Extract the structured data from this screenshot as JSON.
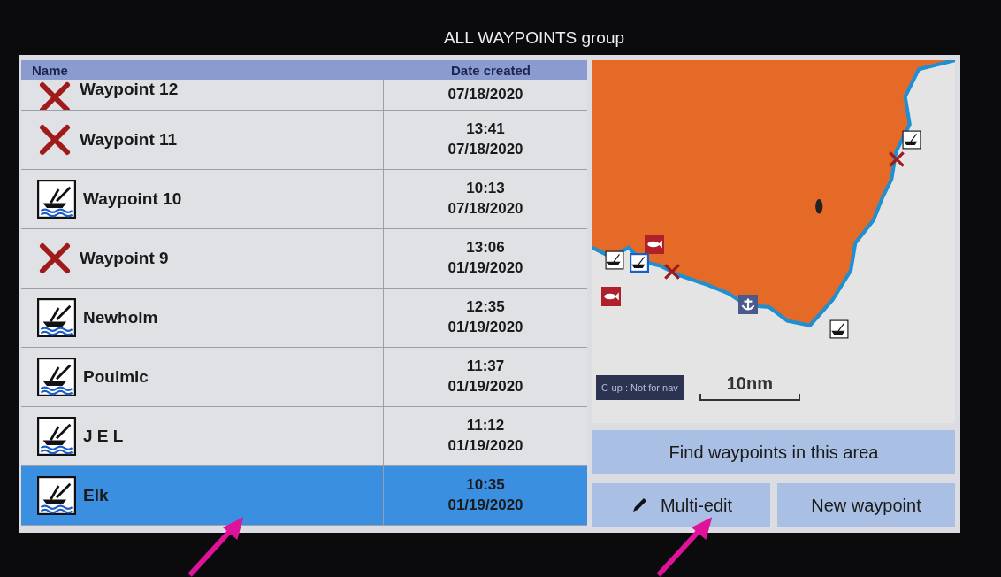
{
  "window": {
    "title": "ALL WAYPOINTS group"
  },
  "table": {
    "columns": [
      "Name",
      "Date created"
    ],
    "rows": [
      {
        "kind": "deleted",
        "name": "Waypoint 12",
        "date": "07/18/2020",
        "selected": false
      },
      {
        "kind": "deleted",
        "name": "Waypoint 11",
        "time": "13:41",
        "date": "07/18/2020",
        "selected": false
      },
      {
        "kind": "fishing",
        "name": "Waypoint 10",
        "time": "10:13",
        "date": "07/18/2020",
        "selected": false
      },
      {
        "kind": "deleted",
        "name": "Waypoint 9",
        "time": "13:06",
        "date": "01/19/2020",
        "selected": false
      },
      {
        "kind": "fishing",
        "name": "Newholm",
        "time": "12:35",
        "date": "01/19/2020",
        "selected": false
      },
      {
        "kind": "fishing",
        "name": "Poulmic",
        "time": "11:37",
        "date": "01/19/2020",
        "selected": false
      },
      {
        "kind": "fishing",
        "name": "J E L",
        "time": "11:12",
        "date": "01/19/2020",
        "selected": false
      },
      {
        "kind": "fishing",
        "name": "Elk",
        "time": "10:35",
        "date": "01/19/2020",
        "selected": true
      }
    ]
  },
  "map": {
    "orientation_label": "C-up : Not for nav",
    "scale": "10nm"
  },
  "buttons": [
    {
      "kind": "wide",
      "label": "Find waypoints in this area"
    },
    {
      "kind": "edit",
      "label": "Multi-edit"
    },
    {
      "kind": "plain",
      "label": "New waypoint"
    }
  ]
}
